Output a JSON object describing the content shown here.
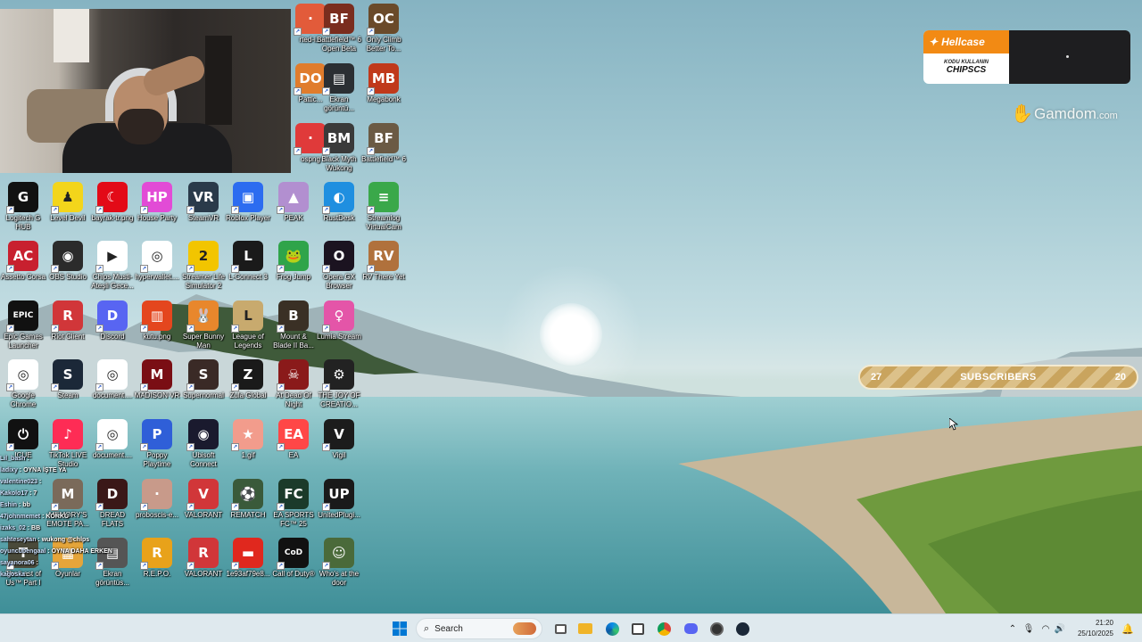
{
  "desktop": {
    "icons": [
      {
        "label": "rted-i...",
        "color": "#e25b3a",
        "glyph": "·"
      },
      {
        "label": "Battlefield™ 6 Open Beta",
        "color": "#7a2d1e",
        "glyph": "BF"
      },
      {
        "label": "Only Climb Better To...",
        "color": "#6a4a2a",
        "glyph": "OC"
      },
      {
        "label": "Pattic...",
        "color": "#e07c2c",
        "glyph": "DO"
      },
      {
        "label": "Ekran görüntü...",
        "color": "#2b2f33",
        "glyph": "▤"
      },
      {
        "label": "Megabonk",
        "color": "#c0391b",
        "glyph": "MB"
      },
      {
        "label": "ospng",
        "color": "#e03a3a",
        "glyph": "·"
      },
      {
        "label": "Black Myth Wukong",
        "color": "#3a3a3a",
        "glyph": "BM"
      },
      {
        "label": "Battlefield™ 6",
        "color": "#6b5a44",
        "glyph": "BF"
      },
      {
        "label": "Logitech G HUB",
        "color": "#111111",
        "glyph": "G"
      },
      {
        "label": "Level Devil",
        "color": "#f3d51b",
        "glyph": "♟"
      },
      {
        "label": "bayrak-tr.png",
        "color": "#e30a17",
        "glyph": "☾"
      },
      {
        "label": "House Party",
        "color": "#e24bd6",
        "glyph": "HP"
      },
      {
        "label": "SteamVR",
        "color": "#2a3a4a",
        "glyph": "VR"
      },
      {
        "label": "Roblox Player",
        "color": "#2c6cf0",
        "glyph": "▣"
      },
      {
        "label": "PEAK",
        "color": "#b28fd0",
        "glyph": "▲"
      },
      {
        "label": "RustDesk",
        "color": "#1f8fe0",
        "glyph": "◐"
      },
      {
        "label": "Streamlog VirtualCam",
        "color": "#3aa84a",
        "glyph": "≡"
      },
      {
        "label": "Assetto Corsa",
        "color": "#c8202f",
        "glyph": "AC"
      },
      {
        "label": "OBS Studio",
        "color": "#2b2b2b",
        "glyph": "◉"
      },
      {
        "label": "Chips Musti-Ateşli Gece...",
        "color": "#ffffff",
        "glyph": "▶"
      },
      {
        "label": "hyperwallet....",
        "color": "#ffffff",
        "glyph": "◎"
      },
      {
        "label": "Streamer Life Simulator 2",
        "color": "#f2c500",
        "glyph": "2"
      },
      {
        "label": "L-Connect 3",
        "color": "#1a1a1a",
        "glyph": "L"
      },
      {
        "label": "Frog Jump",
        "color": "#2fa44a",
        "glyph": "🐸"
      },
      {
        "label": "Opera GX Browser",
        "color": "#1b1320",
        "glyph": "O"
      },
      {
        "label": "RV There Yet",
        "color": "#b0713c",
        "glyph": "RV"
      },
      {
        "label": "Epic Games Launcher",
        "color": "#111111",
        "glyph": "EPIC"
      },
      {
        "label": "Riot Client",
        "color": "#d13639",
        "glyph": "R"
      },
      {
        "label": "Discord",
        "color": "#5865f2",
        "glyph": "D"
      },
      {
        "label": "kutu.png",
        "color": "#e4461e",
        "glyph": "▥"
      },
      {
        "label": "Super Bunny Man",
        "color": "#e8872c",
        "glyph": "🐰"
      },
      {
        "label": "League of Legends",
        "color": "#c8aa6e",
        "glyph": "L"
      },
      {
        "label": "Mount & Blade II Ba...",
        "color": "#3a3025",
        "glyph": "B"
      },
      {
        "label": "Lumia Stream",
        "color": "#e455a8",
        "glyph": "♀"
      },
      {
        "label": "Google Chrome",
        "color": "#ffffff",
        "glyph": "◎"
      },
      {
        "label": "Steam",
        "color": "#1b2838",
        "glyph": "S"
      },
      {
        "label": "document....",
        "color": "#ffffff",
        "glyph": "◎"
      },
      {
        "label": "MADISON VR",
        "color": "#7a0e14",
        "glyph": "M"
      },
      {
        "label": "Supernormal",
        "color": "#3a2a26",
        "glyph": "S"
      },
      {
        "label": "Zula Global",
        "color": "#1a1a1a",
        "glyph": "Z"
      },
      {
        "label": "At Dead Of Night",
        "color": "#8a1a1a",
        "glyph": "☠"
      },
      {
        "label": "THE JOY OF CREATIO...",
        "color": "#222222",
        "glyph": "⚙"
      },
      {
        "label": "ICUE",
        "color": "#111111",
        "glyph": "⏻"
      },
      {
        "label": "TikTok LIVE Studio",
        "color": "#fe2c55",
        "glyph": "♪"
      },
      {
        "label": "document....",
        "color": "#ffffff",
        "glyph": "◎"
      },
      {
        "label": "Poppy Playtime",
        "color": "#2f5fd8",
        "glyph": "P"
      },
      {
        "label": "Ubisoft Connect",
        "color": "#1a1a2e",
        "glyph": "◉"
      },
      {
        "label": "1.gif",
        "color": "#f29c8c",
        "glyph": "★"
      },
      {
        "label": "EA",
        "color": "#ff4747",
        "glyph": "EA"
      },
      {
        "label": "Vigil",
        "color": "#1c1c1c",
        "glyph": "V"
      },
      {
        "label": "MEMORY'S EMOTE PA...",
        "color": "#7a6a5a",
        "glyph": "M"
      },
      {
        "label": "DREAD FLATS",
        "color": "#3a1818",
        "glyph": "D"
      },
      {
        "label": "proboscis-e...",
        "color": "#c89a8a",
        "glyph": "·"
      },
      {
        "label": "VALORANT",
        "color": "#d13639",
        "glyph": "V"
      },
      {
        "label": "REMATCH",
        "color": "#3a5a3a",
        "glyph": "⚽"
      },
      {
        "label": "EA SPORTS FC™ 25",
        "color": "#1b3a2a",
        "glyph": "FC"
      },
      {
        "label": "UnitedPlugi...",
        "color": "#1a1a1a",
        "glyph": "UP"
      },
      {
        "label": "Oyunlar",
        "color": "#e5a53a",
        "glyph": "▦"
      },
      {
        "label": "Ekran görüntüs...",
        "color": "#555555",
        "glyph": "▤"
      },
      {
        "label": "R.E.P.O.",
        "color": "#e8a21a",
        "glyph": "R"
      },
      {
        "label": "VALORANT",
        "color": "#d13639",
        "glyph": "R"
      },
      {
        "label": "1e93af79e8...",
        "color": "#e0281e",
        "glyph": "▬"
      },
      {
        "label": "Call of Duty®",
        "color": "#111111",
        "glyph": "CoD"
      },
      {
        "label": "Who's at the door",
        "color": "#4a6a3a",
        "glyph": "☺"
      },
      {
        "label": "The Last of Us™ Part I",
        "color": "#4a4a3a",
        "glyph": "T"
      }
    ]
  },
  "chat": [
    {
      "user": "Lil_bash",
      "text": ":"
    },
    {
      "user": "ladixy",
      "text": ": OYNA İŞTE YA"
    },
    {
      "user": "valentine023",
      "text": ":"
    },
    {
      "user": "Kakolo17",
      "text": ": 7"
    },
    {
      "user": "Eshin",
      "text": ": bb"
    },
    {
      "user": "47johnmemet",
      "text": ": KORKU"
    },
    {
      "user": "izaks_02",
      "text": ": BB"
    },
    {
      "user": "sahteseytan",
      "text": ": wukong @chlps"
    },
    {
      "user": "oyuncubengaal",
      "text": ": OYNA DAHA ERKEN"
    },
    {
      "user": "sayanora06",
      "text": ":"
    },
    {
      "user": "kagoska",
      "text": ":"
    }
  ],
  "widgets": {
    "hellcase": {
      "brand": "Hellcase",
      "code_label": "KODU KULLANIN",
      "code": "CHIPSCS"
    },
    "gamdom": {
      "name": "Gamdom",
      "suffix": ".com"
    },
    "subscribers": {
      "current": "27",
      "title": "SUBSCRIBERS",
      "goal": "20"
    }
  },
  "taskbar": {
    "search_placeholder": "Search",
    "time": "21:20",
    "date": "25/10/2025",
    "accent": "#0078d4"
  }
}
